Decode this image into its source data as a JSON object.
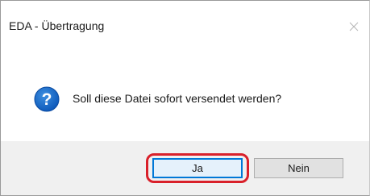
{
  "window": {
    "title": "EDA - Übertragung",
    "close_icon": "close-icon"
  },
  "dialog": {
    "icon": "question-icon",
    "message": "Soll diese Datei sofort versendet werden?"
  },
  "buttons": {
    "yes_label": "Ja",
    "no_label": "Nein"
  },
  "colors": {
    "accent": "#0078d7",
    "highlight": "#d9202a",
    "button_bar": "#f0f0f0"
  }
}
